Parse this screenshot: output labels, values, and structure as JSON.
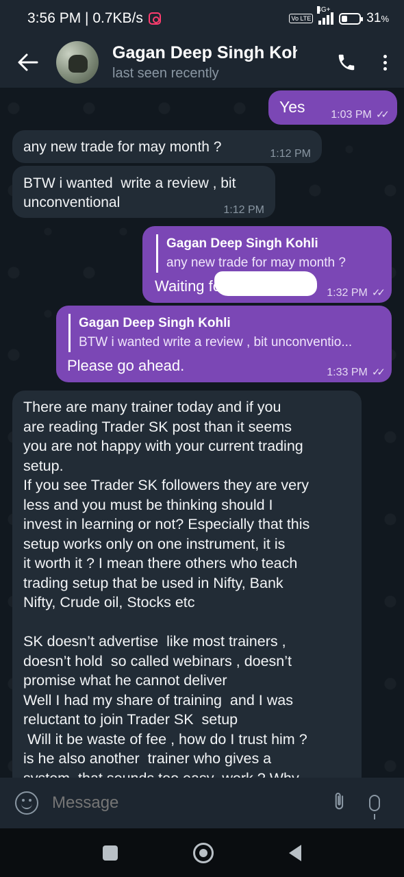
{
  "status_bar": {
    "time_speed": "3:56 PM | 0.7KB/s",
    "volte": "Vo LTE",
    "network": "4G+",
    "battery": "31",
    "battery_unit": "%"
  },
  "header": {
    "contact_name": "Gagan Deep Singh Kohli",
    "status": "last seen recently"
  },
  "messages": [
    {
      "side": "out",
      "text": "Yes",
      "time": "1:03 PM"
    },
    {
      "side": "in",
      "text": "any  new  trade for may month ?",
      "time": "1:12 PM"
    },
    {
      "side": "in",
      "text": "BTW i wanted  write a review , bit unconventional",
      "time": "1:12 PM"
    },
    {
      "side": "out",
      "reply_name": "Gagan Deep Singh Kohli",
      "reply_text": "any  new  trade for may month ?",
      "text": "Waiting for t",
      "time": "1:32 PM"
    },
    {
      "side": "out",
      "reply_name": "Gagan Deep Singh Kohli",
      "reply_text": "BTW i wanted  write a review , bit unconventio...",
      "text": "Please go ahead.",
      "time": "1:33 PM"
    },
    {
      "side": "in",
      "text": "There are many trainer today and if you\nare reading Trader SK post than it seems\nyou are not happy with your current trading\nsetup.\nIf you see Trader SK followers they are very\nless and you must be thinking should I\ninvest in learning or not? Especially that this\nsetup works only on one instrument, it is\nit worth it ? I mean there others who teach\ntrading setup that be used in Nifty, Bank\nNifty, Crude oil, Stocks etc\n\nSK doesn’t advertise  like most trainers ,\ndoesn’t hold  so called webinars , doesn’t\npromise what he cannot deliver\nWell I had my share of training  and I was\nreluctant to join Trader SK  setup\n Will it be waste of fee , how do I trust him ?\nis he also another  trainer who gives a\nsystem  that sounds too easy  work ? Why"
    }
  ],
  "input": {
    "placeholder": "Message"
  },
  "icons": {
    "back": "back-arrow-icon",
    "call": "phone-icon",
    "menu": "more-vert-icon",
    "emoji": "emoji-icon",
    "attach": "paperclip-icon",
    "mic": "microphone-icon"
  },
  "colors": {
    "outgoing_bubble": "#7b47b5",
    "incoming_bubble": "#222c36",
    "header": "#1d2630",
    "chat_background": "#11181f"
  }
}
